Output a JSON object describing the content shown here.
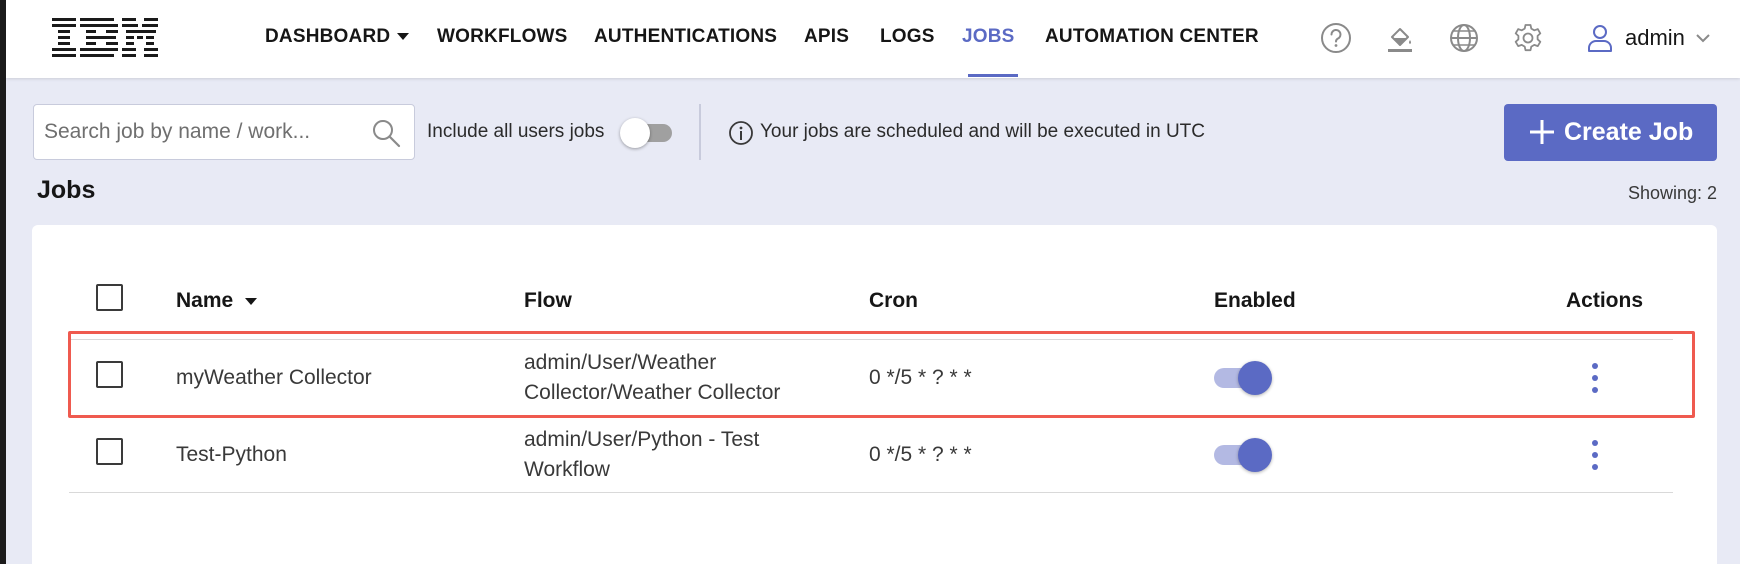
{
  "app": {
    "logo_text": "IBM",
    "accent_color": "#5b6ac4",
    "highlight_color": "#ef5a4f"
  },
  "nav": {
    "items": [
      {
        "label": "DASHBOARD",
        "has_dropdown": true
      },
      {
        "label": "WORKFLOWS"
      },
      {
        "label": "AUTHENTICATIONS"
      },
      {
        "label": "APIS"
      },
      {
        "label": "LOGS"
      },
      {
        "label": "JOBS",
        "active": true
      },
      {
        "label": "AUTOMATION CENTER"
      }
    ],
    "icons": [
      "help-icon",
      "theme-paint-icon",
      "globe-icon",
      "settings-gear-icon",
      "user-icon"
    ],
    "user": "admin"
  },
  "toolbar": {
    "search_placeholder": "Search job by name / work...",
    "include_all_label": "Include all users jobs",
    "include_all_enabled": false,
    "info_text": "Your jobs are scheduled and will be executed in UTC",
    "create_label": "Create Job"
  },
  "section": {
    "title": "Jobs",
    "showing": "Showing: 2"
  },
  "table": {
    "columns": [
      "Name",
      "Flow",
      "Cron",
      "Enabled",
      "Actions"
    ],
    "sort_column": "Name",
    "rows": [
      {
        "name": "myWeather Collector",
        "flow_line1": "admin/User/Weather",
        "flow_line2": "Collector/Weather Collector",
        "cron": "0 */5 * ? * *",
        "enabled": true,
        "highlighted": true
      },
      {
        "name": "Test-Python",
        "flow_line1": "admin/User/Python - Test",
        "flow_line2": "Workflow",
        "cron": "0 */5 * ? * *",
        "enabled": true,
        "highlighted": false
      }
    ]
  }
}
